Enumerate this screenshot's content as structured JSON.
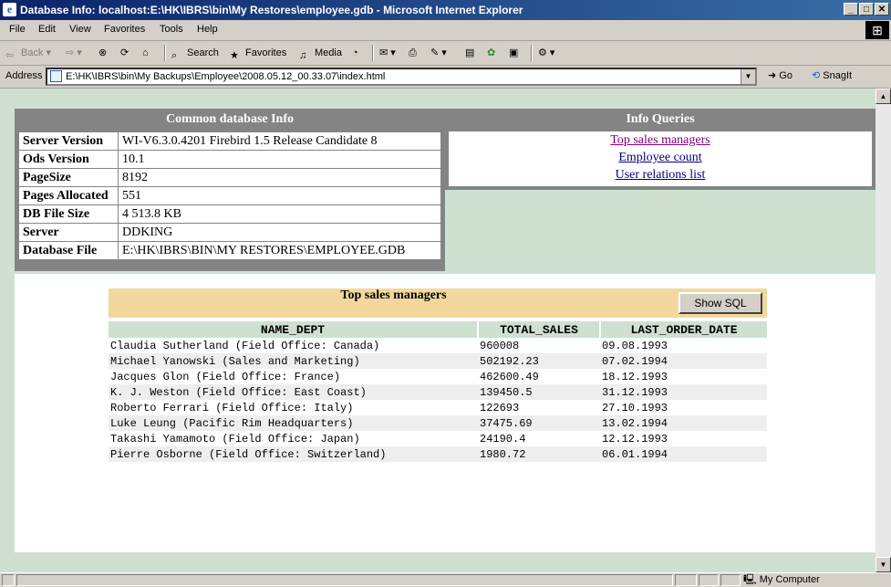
{
  "window": {
    "title": "Database Info: localhost:E:\\HK\\IBRS\\bin\\My Restores\\employee.gdb - Microsoft Internet Explorer"
  },
  "menu": [
    "File",
    "Edit",
    "View",
    "Favorites",
    "Tools",
    "Help"
  ],
  "toolbar": {
    "back": "Back",
    "search": "Search",
    "favorites": "Favorites",
    "media": "Media"
  },
  "address": {
    "label": "Address",
    "url": "E:\\HK\\IBRS\\bin\\My Backups\\Employee\\2008.05.12_00.33.07\\index.html",
    "go": "Go",
    "snagit": "SnagIt"
  },
  "info": {
    "header": "Common database Info",
    "rows": [
      {
        "key": "Server Version",
        "value": "WI-V6.3.0.4201 Firebird 1.5 Release Candidate 8"
      },
      {
        "key": "Ods Version",
        "value": "10.1"
      },
      {
        "key": "PageSize",
        "value": "8192"
      },
      {
        "key": "Pages Allocated",
        "value": "551"
      },
      {
        "key": "DB File Size",
        "value": "4 513.8 KB"
      },
      {
        "key": "Server",
        "value": "DDKING"
      },
      {
        "key": "Database File",
        "value": "E:\\HK\\IBRS\\BIN\\MY RESTORES\\EMPLOYEE.GDB"
      }
    ]
  },
  "queries": {
    "header": "Info Queries",
    "links": [
      "Top sales managers",
      "Employee count",
      "User relations list"
    ]
  },
  "results": {
    "title": "Top sales managers",
    "show_sql": "Show SQL",
    "columns": [
      "NAME_DEPT",
      "TOTAL_SALES",
      "LAST_ORDER_DATE"
    ],
    "rows": [
      [
        "Claudia Sutherland (Field Office: Canada)",
        "960008",
        "09.08.1993"
      ],
      [
        "Michael Yanowski (Sales and Marketing)",
        "502192.23",
        "07.02.1994"
      ],
      [
        "Jacques Glon (Field Office: France)",
        "462600.49",
        "18.12.1993"
      ],
      [
        "K. J. Weston (Field Office: East Coast)",
        "139450.5",
        "31.12.1993"
      ],
      [
        "Roberto Ferrari (Field Office: Italy)",
        "122693",
        "27.10.1993"
      ],
      [
        "Luke Leung (Pacific Rim Headquarters)",
        "37475.69",
        "13.02.1994"
      ],
      [
        "Takashi Yamamoto (Field Office: Japan)",
        "24190.4",
        "12.12.1993"
      ],
      [
        "Pierre Osborne (Field Office: Switzerland)",
        "1980.72",
        "06.01.1994"
      ]
    ]
  },
  "status": {
    "zone": "My Computer"
  }
}
